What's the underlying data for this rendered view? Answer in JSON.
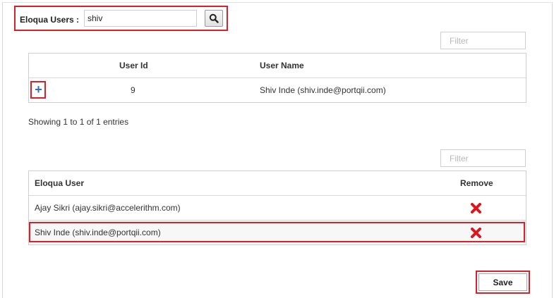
{
  "search": {
    "label": "Eloqua Users :",
    "value": "shiv",
    "button_icon": "search-icon"
  },
  "results": {
    "filter_placeholder": "Filter",
    "columns": [
      "User Id",
      "User Name"
    ],
    "rows": [
      {
        "add_icon": "+",
        "user_id": "9",
        "user_name": "Shiv Inde (shiv.inde@portqii.com)"
      }
    ],
    "info": "Showing 1 to 1 of 1 entries"
  },
  "selected": {
    "filter_placeholder": "Filter",
    "columns": [
      "Eloqua User",
      "Remove"
    ],
    "rows": [
      {
        "user": "Ajay Sikri (ajay.sikri@accelerithm.com)",
        "remove_icon": "remove-icon"
      },
      {
        "user": "Shiv Inde (shiv.inde@portqii.com)",
        "remove_icon": "remove-icon"
      }
    ]
  },
  "actions": {
    "save_label": "Save"
  },
  "colors": {
    "highlight_border": "#d9212a",
    "remove_icon": "#e0141b",
    "add_icon": "#2a73c2"
  }
}
